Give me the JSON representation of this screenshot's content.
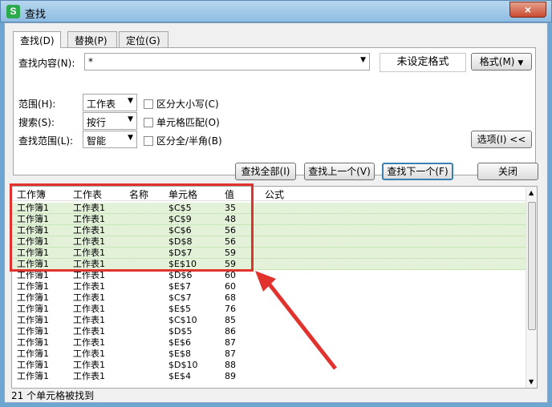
{
  "window": {
    "title": "查找",
    "app_icon": "S",
    "close_glyph": "×"
  },
  "tabs": [
    {
      "label": "查找(D)"
    },
    {
      "label": "替换(P)"
    },
    {
      "label": "定位(G)"
    }
  ],
  "find": {
    "label": "查找内容(N):",
    "value": "*",
    "format_status": "未设定格式",
    "format_button": "格式(M)"
  },
  "options": {
    "scope_label": "范围(H):",
    "scope_value": "工作表",
    "search_label": "搜索(S):",
    "search_value": "按行",
    "range_label": "查找范围(L):",
    "range_value": "智能",
    "case_label": "区分大小写(C)",
    "cell_match_label": "单元格匹配(O)",
    "width_label": "区分全/半角(B)",
    "options_button": "选项(I) <<"
  },
  "actions": {
    "find_all": "查找全部(I)",
    "find_prev": "查找上一个(V)",
    "find_next": "查找下一个(F)",
    "close": "关闭"
  },
  "results": {
    "headers": [
      "工作簿",
      "工作表",
      "名称",
      "单元格",
      "值",
      "公式"
    ],
    "rows": [
      [
        "工作簿1",
        "工作表1",
        "",
        "$C$5",
        "35",
        ""
      ],
      [
        "工作簿1",
        "工作表1",
        "",
        "$C$9",
        "48",
        ""
      ],
      [
        "工作簿1",
        "工作表1",
        "",
        "$C$6",
        "56",
        ""
      ],
      [
        "工作簿1",
        "工作表1",
        "",
        "$D$8",
        "56",
        ""
      ],
      [
        "工作簿1",
        "工作表1",
        "",
        "$D$7",
        "59",
        ""
      ],
      [
        "工作簿1",
        "工作表1",
        "",
        "$E$10",
        "59",
        ""
      ],
      [
        "工作簿1",
        "工作表1",
        "",
        "$D$6",
        "60",
        ""
      ],
      [
        "工作簿1",
        "工作表1",
        "",
        "$E$7",
        "60",
        ""
      ],
      [
        "工作簿1",
        "工作表1",
        "",
        "$C$7",
        "68",
        ""
      ],
      [
        "工作簿1",
        "工作表1",
        "",
        "$E$5",
        "76",
        ""
      ],
      [
        "工作簿1",
        "工作表1",
        "",
        "$C$10",
        "85",
        ""
      ],
      [
        "工作簿1",
        "工作表1",
        "",
        "$D$5",
        "86",
        ""
      ],
      [
        "工作簿1",
        "工作表1",
        "",
        "$E$6",
        "87",
        ""
      ],
      [
        "工作簿1",
        "工作表1",
        "",
        "$E$8",
        "87",
        ""
      ],
      [
        "工作簿1",
        "工作表1",
        "",
        "$D$10",
        "88",
        ""
      ],
      [
        "工作簿1",
        "工作表1",
        "",
        "$E$4",
        "89",
        ""
      ]
    ],
    "highlighted_count": 6
  },
  "status": "21 个单元格被找到",
  "colors": {
    "highlight": "#e2f1d8",
    "annotation": "#e2322e",
    "title_bar": "#8fbde3"
  }
}
